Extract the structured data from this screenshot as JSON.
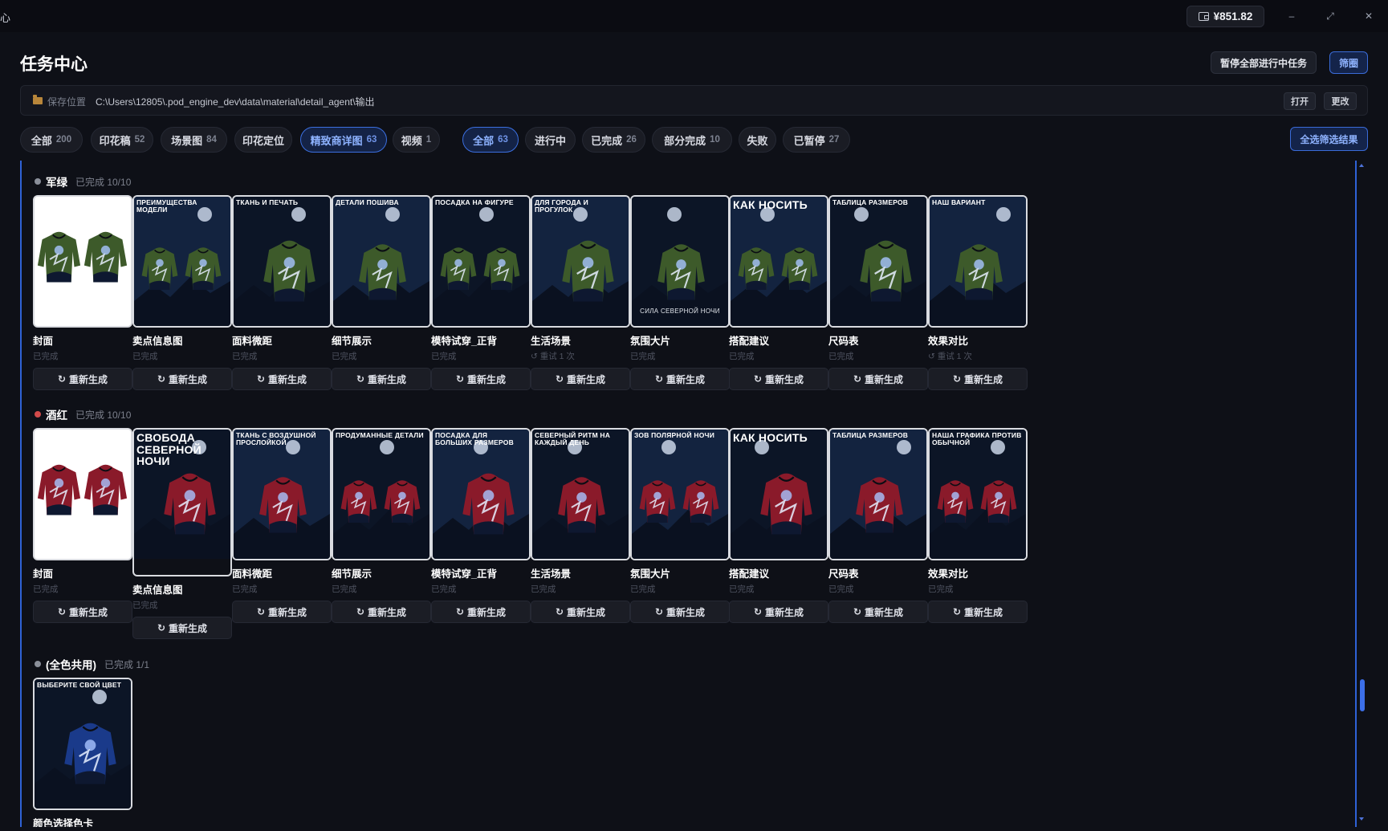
{
  "titlebar": {
    "app_glyph": "心",
    "balance": "¥851.82",
    "minimize": "–",
    "maximize": "⤢",
    "close": "✕"
  },
  "header": {
    "title": "任务中心",
    "pause_all": "暂停全部进行中任务",
    "filter": "筛圈"
  },
  "pathbar": {
    "label": "保存位置",
    "path": "C:\\Users\\12805\\.pod_engine_dev\\data\\material\\detail_agent\\输出",
    "open": "打开",
    "change": "更改"
  },
  "type_chips": [
    {
      "label": "全部",
      "count": "200",
      "active": false
    },
    {
      "label": "印花稿",
      "count": "52",
      "active": false
    },
    {
      "label": "场景图",
      "count": "84",
      "active": false
    },
    {
      "label": "印花定位",
      "count": "",
      "active": false
    },
    {
      "label": "精致商详图",
      "count": "63",
      "active": true
    },
    {
      "label": "视频",
      "count": "1",
      "active": false
    }
  ],
  "status_chips": [
    {
      "label": "全部",
      "count": "63",
      "active": true
    },
    {
      "label": "进行中",
      "count": "",
      "active": false
    },
    {
      "label": "已完成",
      "count": "26",
      "active": false
    },
    {
      "label": "部分完成",
      "count": "10",
      "active": false
    },
    {
      "label": "失败",
      "count": "",
      "active": false
    },
    {
      "label": "已暂停",
      "count": "27",
      "active": false
    }
  ],
  "select_all_label": "全选筛选结果",
  "regen_label": "重新生成",
  "groups": [
    {
      "name": "军绿",
      "status": "已完成 10/10",
      "dot_color": "#8a8f9a",
      "accent": "#3d5a2a",
      "cards": [
        {
          "name": "封面",
          "status": "已完成",
          "banner": ""
        },
        {
          "name": "卖点信息图",
          "status": "已完成",
          "banner": "ПРЕИМУЩЕСТВА МОДЕЛИ"
        },
        {
          "name": "面料微距",
          "status": "已完成",
          "banner": "ТКАНЬ И ПЕЧАТЬ"
        },
        {
          "name": "细节展示",
          "status": "已完成",
          "banner": "ДЕТАЛИ ПОШИВА"
        },
        {
          "name": "模特试穿_正背",
          "status": "已完成",
          "banner": "ПОСАДКА НА ФИГУРЕ"
        },
        {
          "name": "生活场景",
          "status": "↺ 重试 1 次",
          "banner": "ДЛЯ ГОРОДА И ПРОГУЛОК"
        },
        {
          "name": "氛围大片",
          "status": "已完成",
          "banner": ""
        },
        {
          "name": "搭配建议",
          "status": "已完成",
          "banner": "КАК НОСИТЬ"
        },
        {
          "name": "尺码表",
          "status": "已完成",
          "banner": "ТАБЛИЦА РАЗМЕРОВ"
        },
        {
          "name": "效果对比",
          "status": "↺ 重试 1 次",
          "banner": "НАШ ВАРИАНТ"
        }
      ]
    },
    {
      "name": "酒红",
      "status": "已完成 10/10",
      "dot_color": "#d24a4a",
      "accent": "#8a1a2a",
      "cards": [
        {
          "name": "封面",
          "status": "已完成",
          "banner": ""
        },
        {
          "name": "卖点信息图",
          "status": "已完成",
          "banner": "СВОБОДА СЕВЕРНОЙ НОЧИ"
        },
        {
          "name": "面料微距",
          "status": "已完成",
          "banner": "ТКАНЬ С ВОЗДУШНОЙ ПРОСЛОЙКОЙ"
        },
        {
          "name": "细节展示",
          "status": "已完成",
          "banner": "ПРОДУМАННЫЕ ДЕТАЛИ"
        },
        {
          "name": "模特试穿_正背",
          "status": "已完成",
          "banner": "ПОСАДКА ДЛЯ БОЛЬШИХ РАЗМЕРОВ"
        },
        {
          "name": "生活场景",
          "status": "已完成",
          "banner": "СЕВЕРНЫЙ РИТМ НА КАЖДЫЙ ДЕНЬ"
        },
        {
          "name": "氛围大片",
          "status": "已完成",
          "banner": "ЗОВ ПОЛЯРНОЙ НОЧИ"
        },
        {
          "name": "搭配建议",
          "status": "已完成",
          "banner": "КАК НОСИТЬ"
        },
        {
          "name": "尺码表",
          "status": "已完成",
          "banner": "ТАБЛИЦА РАЗМЕРОВ"
        },
        {
          "name": "效果对比",
          "status": "已完成",
          "banner": "НАША ГРАФИКА ПРОТИВ ОБЫЧНОЙ"
        }
      ]
    },
    {
      "name": "(全色共用)",
      "status": "已完成 1/1",
      "dot_color": "#8a8f9a",
      "accent": "#1a3a8a",
      "cards": [
        {
          "name": "颜色选择色卡",
          "status": "",
          "banner": "ВЫБЕРИТЕ СВОЙ ЦВЕТ"
        }
      ]
    }
  ],
  "thumb_captions": {
    "g0_c6": "СИЛА СЕВЕРНОЙ НОЧИ"
  }
}
